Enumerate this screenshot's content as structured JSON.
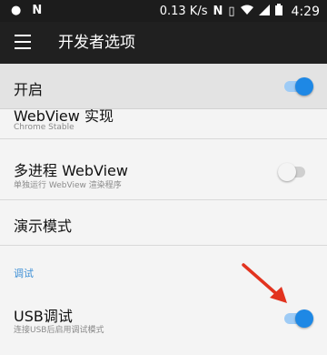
{
  "status_bar": {
    "network_speed": "0.13 K/s",
    "time": "4:29",
    "icons": [
      "status-dot-icon",
      "notification-n-icon",
      "nfc-icon",
      "vibrate-icon",
      "wifi-icon",
      "signal-icon",
      "battery-icon"
    ]
  },
  "app_bar": {
    "title": "开发者选项",
    "menu_icon": "menu-icon"
  },
  "master_switch": {
    "label": "开启",
    "state": true
  },
  "settings": {
    "webview_impl": {
      "title": "WebView 实现",
      "summary": "Chrome Stable"
    },
    "multiprocess_webview": {
      "title": "多进程 WebView",
      "summary": "单独运行 WebView 渲染程序",
      "state": false
    },
    "demo_mode": {
      "title": "演示模式"
    },
    "debug_section": {
      "header": "调试"
    },
    "usb_debugging": {
      "title": "USB调试",
      "summary": "连接USB后启用调试模式",
      "state": true
    }
  },
  "colors": {
    "accent": "#1e88e5",
    "arrow": "#e2331f",
    "app_bar": "#202020"
  }
}
